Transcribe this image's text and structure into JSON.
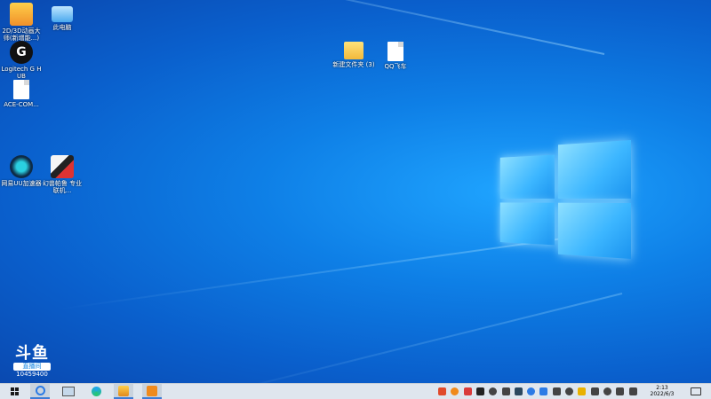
{
  "desktop": {
    "icons": [
      {
        "label": "2D/3D动画大师(新增能...)",
        "icon": "cartoon-app-icon"
      },
      {
        "label": "此电脑",
        "icon": "this-pc-icon"
      },
      {
        "label": "Logitech G HUB",
        "icon": "logitech-g-icon"
      },
      {
        "label": "ACE-COM...",
        "icon": "file-icon"
      },
      {
        "label": "网易UU加速器",
        "icon": "uu-accelerator-icon"
      },
      {
        "label": "幻兽帕鲁 专业联机...",
        "icon": "game-app-icon"
      },
      {
        "label": "新建文件夹 (3)",
        "icon": "folder-icon"
      },
      {
        "label": "QQ飞车",
        "icon": "file-icon"
      }
    ]
  },
  "watermark": {
    "logo": "斗鱼",
    "badge": "直播间",
    "room": "10459400"
  },
  "taskbar": {
    "start_icon": "windows-start-icon",
    "apps": [
      {
        "name": "browser-360-icon"
      },
      {
        "name": "task-view-icon"
      },
      {
        "name": "edge-icon"
      },
      {
        "name": "avatar-app-icon"
      },
      {
        "name": "orange-app-icon"
      }
    ],
    "tray": [
      {
        "name": "qq-icon",
        "color": "#e04a2b"
      },
      {
        "name": "orange-tray-icon",
        "color": "#f08a1c"
      },
      {
        "name": "red-tray-icon",
        "color": "#d93b3b"
      },
      {
        "name": "circle-g-icon",
        "color": "#222222"
      },
      {
        "name": "gear-tray-icon",
        "color": "#444444"
      },
      {
        "name": "mic-icon",
        "color": "#444444"
      },
      {
        "name": "steam-icon",
        "color": "#2a475e"
      },
      {
        "name": "sync-icon",
        "color": "#2c7be5"
      },
      {
        "name": "blue-tray-icon",
        "color": "#2c7be5"
      },
      {
        "name": "monitor-icon",
        "color": "#444444"
      },
      {
        "name": "chat-icon",
        "color": "#444444"
      },
      {
        "name": "yellow-tray-icon",
        "color": "#e8b100"
      },
      {
        "name": "cloud-icon",
        "color": "#444444"
      },
      {
        "name": "network-icon",
        "color": "#444444"
      },
      {
        "name": "volume-icon",
        "color": "#444444"
      },
      {
        "name": "language-icon",
        "color": "#444444"
      }
    ],
    "clock_time": "2:13",
    "clock_date": "2022/6/3",
    "notification_icon": "notification-icon",
    "colors": {
      "bar": "#dfe6ee",
      "accent": "#3b7bd6"
    }
  }
}
